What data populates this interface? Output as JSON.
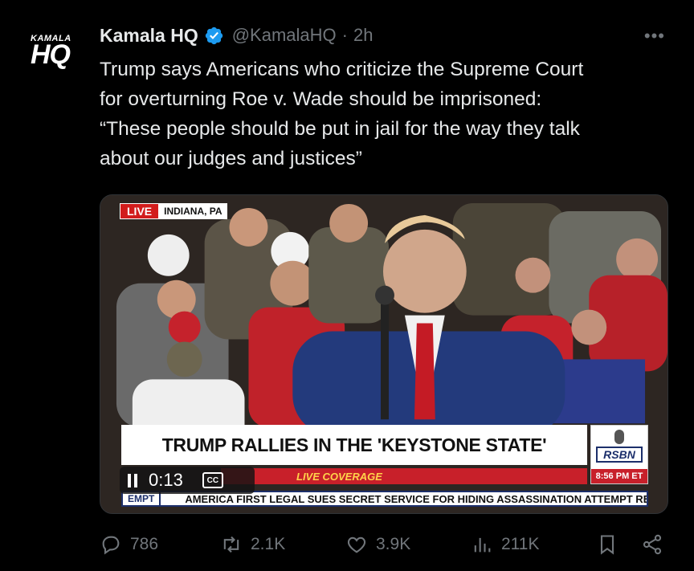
{
  "tweet": {
    "avatar_text_small": "KAMALA",
    "avatar_text_big": "HQ",
    "display_name": "Kamala HQ",
    "handle": "@KamalaHQ",
    "separator": "·",
    "time": "2h",
    "more_label": "•••",
    "text_lines": [
      "Trump says Americans who criticize the Supreme Court",
      "for overturning Roe v. Wade should be imprisoned:",
      "“These people should be put in jail for the way they talk",
      "about our judges and justices”"
    ]
  },
  "media": {
    "live_label": "LIVE",
    "location": "INDIANA, PA",
    "headline": "TRUMP RALLIES IN THE 'KEYSTONE STATE'",
    "coverage": "LIVE COVERAGE",
    "network": "RSBN",
    "clock": "8:56 PM ET",
    "ticker_lead": "EMPT",
    "ticker_text": "AMERICA FIRST LEGAL SUES SECRET SERVICE FOR HIDING ASSASSINATION ATTEMPT RE",
    "player_time": "0:13",
    "cc_label": "CC"
  },
  "actions": {
    "replies": "786",
    "reposts": "2.1K",
    "likes": "3.9K",
    "views": "211K"
  },
  "colors": {
    "background": "#000000",
    "text": "#e7e9ea",
    "muted": "#71767b",
    "verified": "#1d9bf0",
    "news_red": "#c8202a",
    "news_navy": "#1c2f6b"
  }
}
